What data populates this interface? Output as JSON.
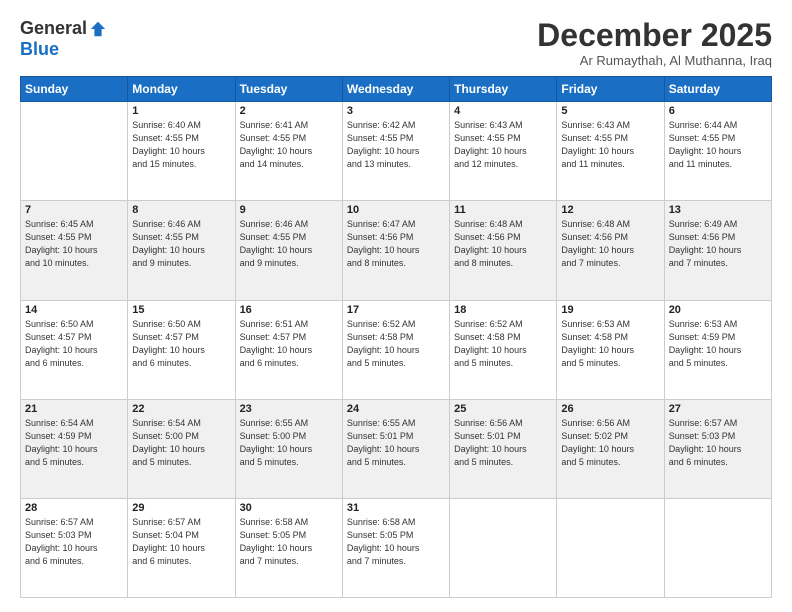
{
  "logo": {
    "general": "General",
    "blue": "Blue"
  },
  "title": "December 2025",
  "subtitle": "Ar Rumaythah, Al Muthanna, Iraq",
  "days_of_week": [
    "Sunday",
    "Monday",
    "Tuesday",
    "Wednesday",
    "Thursday",
    "Friday",
    "Saturday"
  ],
  "weeks": [
    [
      {
        "day": "",
        "info": ""
      },
      {
        "day": "1",
        "info": "Sunrise: 6:40 AM\nSunset: 4:55 PM\nDaylight: 10 hours\nand 15 minutes."
      },
      {
        "day": "2",
        "info": "Sunrise: 6:41 AM\nSunset: 4:55 PM\nDaylight: 10 hours\nand 14 minutes."
      },
      {
        "day": "3",
        "info": "Sunrise: 6:42 AM\nSunset: 4:55 PM\nDaylight: 10 hours\nand 13 minutes."
      },
      {
        "day": "4",
        "info": "Sunrise: 6:43 AM\nSunset: 4:55 PM\nDaylight: 10 hours\nand 12 minutes."
      },
      {
        "day": "5",
        "info": "Sunrise: 6:43 AM\nSunset: 4:55 PM\nDaylight: 10 hours\nand 11 minutes."
      },
      {
        "day": "6",
        "info": "Sunrise: 6:44 AM\nSunset: 4:55 PM\nDaylight: 10 hours\nand 11 minutes."
      }
    ],
    [
      {
        "day": "7",
        "info": "Sunrise: 6:45 AM\nSunset: 4:55 PM\nDaylight: 10 hours\nand 10 minutes."
      },
      {
        "day": "8",
        "info": "Sunrise: 6:46 AM\nSunset: 4:55 PM\nDaylight: 10 hours\nand 9 minutes."
      },
      {
        "day": "9",
        "info": "Sunrise: 6:46 AM\nSunset: 4:55 PM\nDaylight: 10 hours\nand 9 minutes."
      },
      {
        "day": "10",
        "info": "Sunrise: 6:47 AM\nSunset: 4:56 PM\nDaylight: 10 hours\nand 8 minutes."
      },
      {
        "day": "11",
        "info": "Sunrise: 6:48 AM\nSunset: 4:56 PM\nDaylight: 10 hours\nand 8 minutes."
      },
      {
        "day": "12",
        "info": "Sunrise: 6:48 AM\nSunset: 4:56 PM\nDaylight: 10 hours\nand 7 minutes."
      },
      {
        "day": "13",
        "info": "Sunrise: 6:49 AM\nSunset: 4:56 PM\nDaylight: 10 hours\nand 7 minutes."
      }
    ],
    [
      {
        "day": "14",
        "info": "Sunrise: 6:50 AM\nSunset: 4:57 PM\nDaylight: 10 hours\nand 6 minutes."
      },
      {
        "day": "15",
        "info": "Sunrise: 6:50 AM\nSunset: 4:57 PM\nDaylight: 10 hours\nand 6 minutes."
      },
      {
        "day": "16",
        "info": "Sunrise: 6:51 AM\nSunset: 4:57 PM\nDaylight: 10 hours\nand 6 minutes."
      },
      {
        "day": "17",
        "info": "Sunrise: 6:52 AM\nSunset: 4:58 PM\nDaylight: 10 hours\nand 5 minutes."
      },
      {
        "day": "18",
        "info": "Sunrise: 6:52 AM\nSunset: 4:58 PM\nDaylight: 10 hours\nand 5 minutes."
      },
      {
        "day": "19",
        "info": "Sunrise: 6:53 AM\nSunset: 4:58 PM\nDaylight: 10 hours\nand 5 minutes."
      },
      {
        "day": "20",
        "info": "Sunrise: 6:53 AM\nSunset: 4:59 PM\nDaylight: 10 hours\nand 5 minutes."
      }
    ],
    [
      {
        "day": "21",
        "info": "Sunrise: 6:54 AM\nSunset: 4:59 PM\nDaylight: 10 hours\nand 5 minutes."
      },
      {
        "day": "22",
        "info": "Sunrise: 6:54 AM\nSunset: 5:00 PM\nDaylight: 10 hours\nand 5 minutes."
      },
      {
        "day": "23",
        "info": "Sunrise: 6:55 AM\nSunset: 5:00 PM\nDaylight: 10 hours\nand 5 minutes."
      },
      {
        "day": "24",
        "info": "Sunrise: 6:55 AM\nSunset: 5:01 PM\nDaylight: 10 hours\nand 5 minutes."
      },
      {
        "day": "25",
        "info": "Sunrise: 6:56 AM\nSunset: 5:01 PM\nDaylight: 10 hours\nand 5 minutes."
      },
      {
        "day": "26",
        "info": "Sunrise: 6:56 AM\nSunset: 5:02 PM\nDaylight: 10 hours\nand 5 minutes."
      },
      {
        "day": "27",
        "info": "Sunrise: 6:57 AM\nSunset: 5:03 PM\nDaylight: 10 hours\nand 6 minutes."
      }
    ],
    [
      {
        "day": "28",
        "info": "Sunrise: 6:57 AM\nSunset: 5:03 PM\nDaylight: 10 hours\nand 6 minutes."
      },
      {
        "day": "29",
        "info": "Sunrise: 6:57 AM\nSunset: 5:04 PM\nDaylight: 10 hours\nand 6 minutes."
      },
      {
        "day": "30",
        "info": "Sunrise: 6:58 AM\nSunset: 5:05 PM\nDaylight: 10 hours\nand 7 minutes."
      },
      {
        "day": "31",
        "info": "Sunrise: 6:58 AM\nSunset: 5:05 PM\nDaylight: 10 hours\nand 7 minutes."
      },
      {
        "day": "",
        "info": ""
      },
      {
        "day": "",
        "info": ""
      },
      {
        "day": "",
        "info": ""
      }
    ]
  ]
}
